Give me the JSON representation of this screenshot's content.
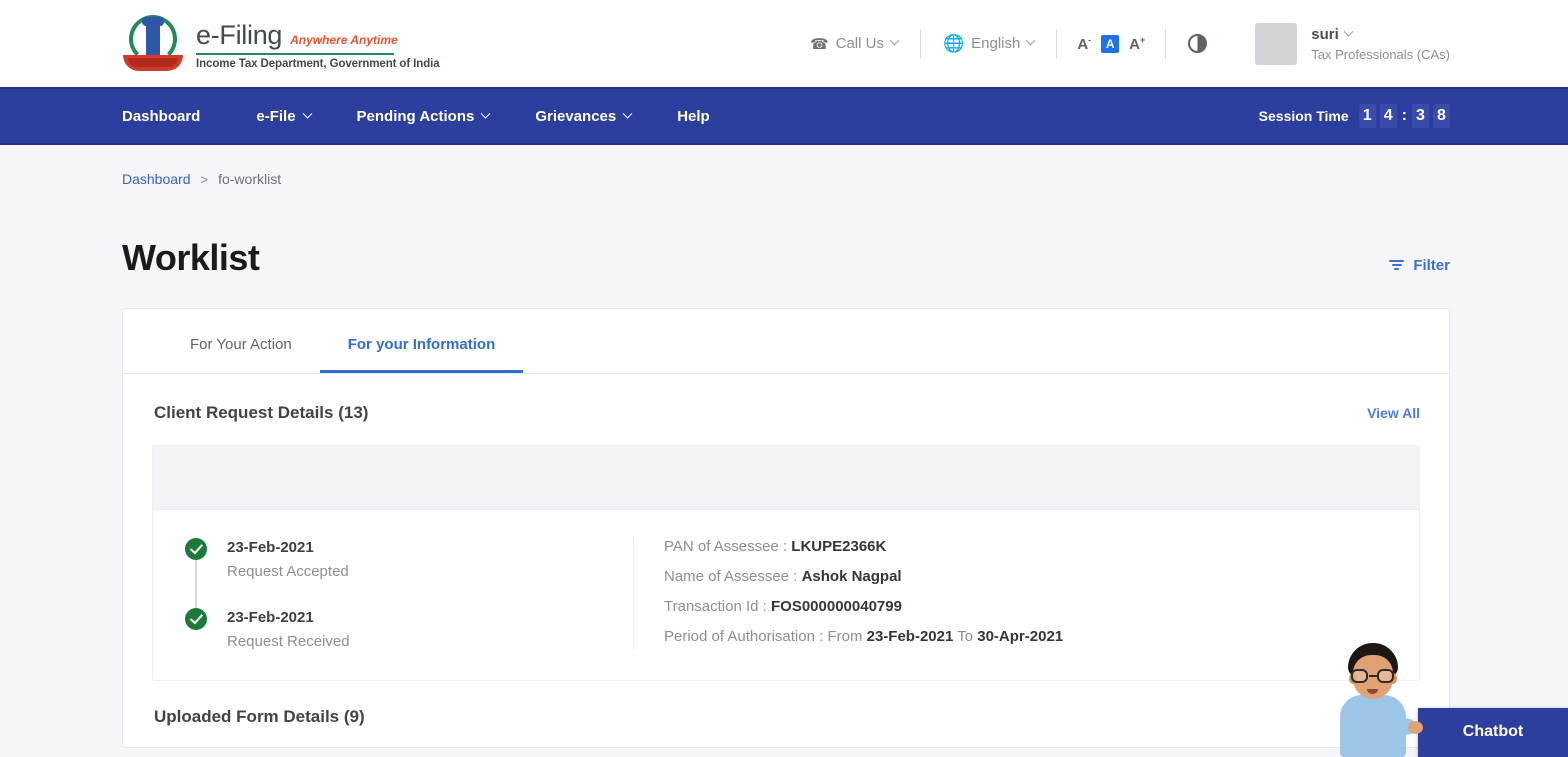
{
  "header": {
    "brand": {
      "title": "e-Filing",
      "tagline": "Anywhere Anytime",
      "subtitle": "Income Tax Department, Government of India",
      "emblem_icon": "india-national-emblem-icon"
    },
    "call_us": {
      "label": "Call Us",
      "icon": "phone-icon"
    },
    "language": {
      "label": "English",
      "icon": "globe-icon"
    },
    "font_size": {
      "decrease": "A",
      "decrease_sup": "-",
      "normal": "A",
      "increase": "A",
      "increase_sup": "+"
    },
    "contrast_icon": "contrast-toggle-icon",
    "profile": {
      "name": "suri",
      "role": "Tax Professionals (CAs)",
      "avatar_icon": "user-avatar-placeholder"
    }
  },
  "nav": {
    "items": [
      {
        "label": "Dashboard",
        "has_dropdown": false
      },
      {
        "label": "e-File",
        "has_dropdown": true
      },
      {
        "label": "Pending Actions",
        "has_dropdown": true
      },
      {
        "label": "Grievances",
        "has_dropdown": true
      },
      {
        "label": "Help",
        "has_dropdown": false
      }
    ],
    "session": {
      "label": "Session Time",
      "digits": [
        "1",
        "4",
        "3",
        "8"
      ],
      "separator": ":"
    }
  },
  "breadcrumb": {
    "root": "Dashboard",
    "separator": ">",
    "current": "fo-worklist"
  },
  "page": {
    "title": "Worklist",
    "filter_label": "Filter"
  },
  "tabs": [
    {
      "label": "For Your Action",
      "active": false
    },
    {
      "label": "For your Information",
      "active": true
    }
  ],
  "client_request": {
    "section_title": "Client Request Details (13)",
    "view_all": "View All",
    "timeline": [
      {
        "date": "23-Feb-2021",
        "status": "Request Accepted"
      },
      {
        "date": "23-Feb-2021",
        "status": "Request Received"
      }
    ],
    "details": {
      "pan_label": "PAN of Assessee :",
      "pan_value": "LKUPE2366K",
      "name_label": "Name of Assessee :",
      "name_value": "Ashok Nagpal",
      "txn_label": "Transaction Id :",
      "txn_value": "FOS000000040799",
      "period_label": "Period of Authorisation :",
      "period_from_label": "From",
      "period_from_value": "23-Feb-2021",
      "period_to_label": "To",
      "period_to_value": "30-Apr-2021"
    }
  },
  "next_section_title": "Uploaded Form Details (9)",
  "chatbot": {
    "label": "Chatbot",
    "avatar_icon": "chatbot-assistant-avatar"
  },
  "colors": {
    "nav_blue": "#2c3e9e",
    "accent_blue": "#2f6fd0",
    "link_blue": "#3761c8",
    "success_green": "#1a7a3c",
    "brand_orange": "#e8542f",
    "brand_green": "#1f8a5a",
    "page_bg": "#f5f5fa"
  }
}
